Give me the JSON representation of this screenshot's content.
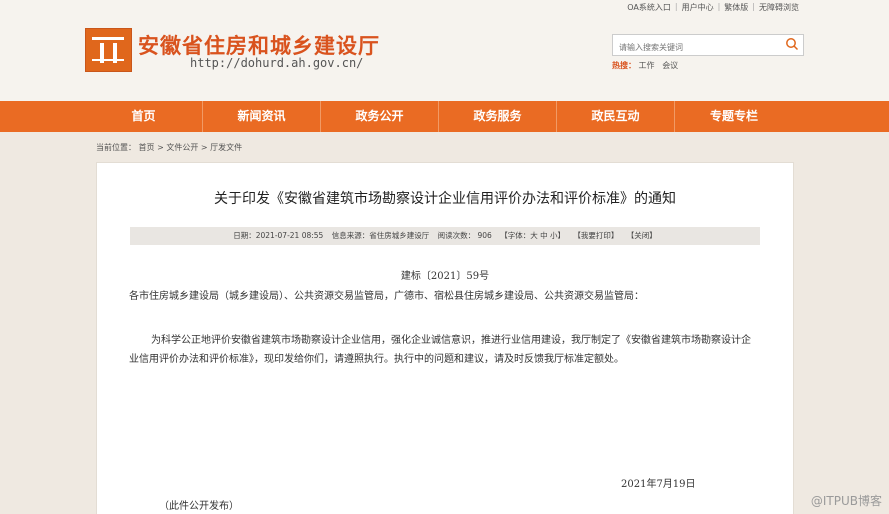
{
  "top_links": [
    "OA系统入口",
    "用户中心",
    "繁体版",
    "无障碍浏览"
  ],
  "site": {
    "title": "安徽省住房和城乡建设厅",
    "url": "http://dohurd.ah.gov.cn/"
  },
  "search": {
    "placeholder": "请输入搜索关键词",
    "hot_label": "热搜：",
    "hot_items": [
      "工作",
      "会议"
    ]
  },
  "nav": [
    "首页",
    "新闻资讯",
    "政务公开",
    "政务服务",
    "政民互动",
    "专题专栏"
  ],
  "breadcrumb": [
    "当前位置：",
    "首页",
    ">",
    "文件公开",
    ">",
    "厅发文件"
  ],
  "article": {
    "title": "关于印发《安徽省建筑市场勘察设计企业信用评价办法和评价标准》的通知",
    "meta_date": "日期：2021-07-21 08:55",
    "meta_source": "信息来源：省住房城乡建设厅",
    "meta_views": "阅读次数：  906",
    "meta_font": "【字体：大 中 小】",
    "meta_print": "【我要打印】",
    "meta_close": "【关闭】",
    "doc_no": "建标〔2021〕59号",
    "recipients": "各市住房城乡建设局（城乡建设局）、公共资源交易监管局，广德市、宿松县住房城乡建设局、公共资源交易监管局：",
    "body": "为科学公正地评价安徽省建筑市场勘察设计企业信用，强化企业诚信意识，推进行业信用建设，我厅制定了《安徽省建筑市场勘察设计企业信用评价办法和评价标准》，现印发给你们，请遵照执行。执行中的问题和建议，请及时反馈我厅标准定额处。",
    "sign_date": "2021年7月19日",
    "publish_note": "（此件公开发布）"
  },
  "watermark": "@ITPUB博客",
  "colors": {
    "brand": "#ea6b23",
    "title": "#d9531e"
  }
}
